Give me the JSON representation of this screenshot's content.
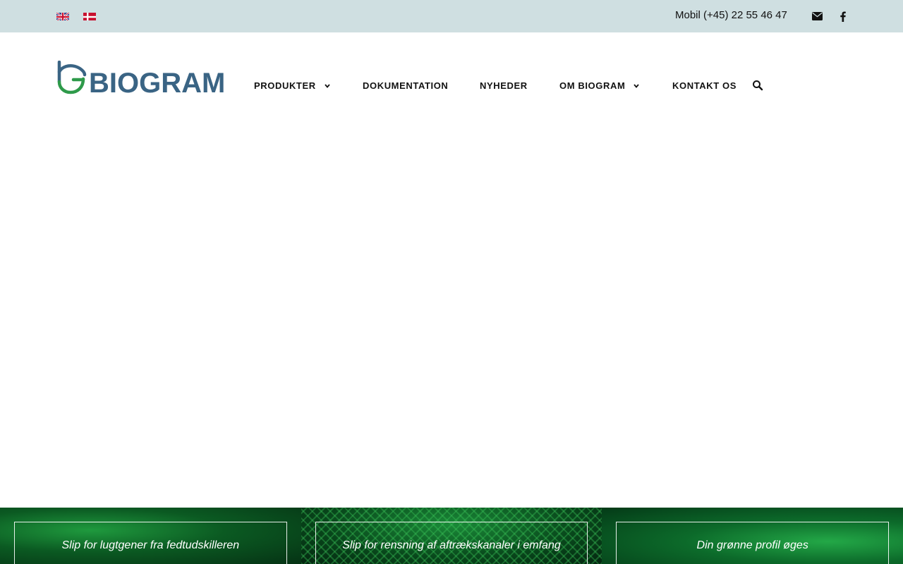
{
  "topbar": {
    "languages": [
      {
        "name": "english-flag-icon"
      },
      {
        "name": "danish-flag-icon"
      }
    ],
    "phone": "Mobil (+45) 22 55 46 47",
    "icons": [
      "envelope-icon",
      "facebook-icon"
    ]
  },
  "brand": {
    "logo_text": "BIOGRAM",
    "colors": {
      "blue": "#3a6484",
      "green": "#2e9a4a"
    }
  },
  "nav": {
    "items": [
      {
        "label": "PRODUKTER",
        "has_dropdown": true
      },
      {
        "label": "DOKUMENTATION",
        "has_dropdown": false
      },
      {
        "label": "NYHEDER",
        "has_dropdown": false
      },
      {
        "label": "OM BIOGRAM",
        "has_dropdown": true
      },
      {
        "label": "KONTAKT OS",
        "has_dropdown": false
      }
    ],
    "search_icon": "search-icon"
  },
  "promos": [
    {
      "text": "Slip for lugtgener fra fedtudskilleren"
    },
    {
      "text": "Slip for rensning af aftrækskanaler i emfang"
    },
    {
      "text": "Din grønne profil øges"
    }
  ],
  "colors": {
    "topbar_bg": "#cfdfe1",
    "promo_green": "#0b5a22"
  }
}
